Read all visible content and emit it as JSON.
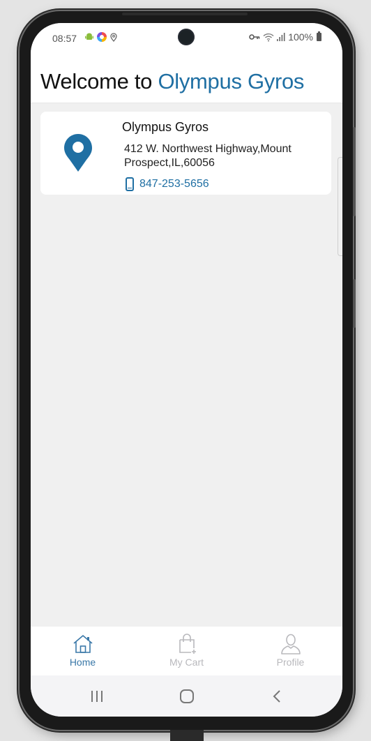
{
  "status_bar": {
    "time": "08:57",
    "left_icons": [
      "android-icon",
      "app-icon",
      "location-icon"
    ],
    "right_icons": [
      "key-icon",
      "wifi-icon",
      "signal-icon"
    ],
    "battery": "100%"
  },
  "header": {
    "prefix": "Welcome to",
    "brand": "Olympus Gyros"
  },
  "store": {
    "name": "Olympus Gyros",
    "address": "412 W. Northwest Highway,Mount Prospect,IL,60056",
    "phone": "847-253-5656",
    "icon": "map-pin-icon"
  },
  "bottom_nav": {
    "items": [
      {
        "label": "Home",
        "icon": "home-icon",
        "active": true
      },
      {
        "label": "My Cart",
        "icon": "shopping-bag-icon",
        "active": false
      },
      {
        "label": "Profile",
        "icon": "user-icon",
        "active": false
      }
    ]
  },
  "system_nav": {
    "buttons": [
      "recent-apps",
      "home",
      "back"
    ]
  },
  "colors": {
    "brand": "#1f6fa3",
    "active_nav": "#3a78a8",
    "inactive_nav": "#b8b8bc",
    "background": "#f0f0f0"
  }
}
